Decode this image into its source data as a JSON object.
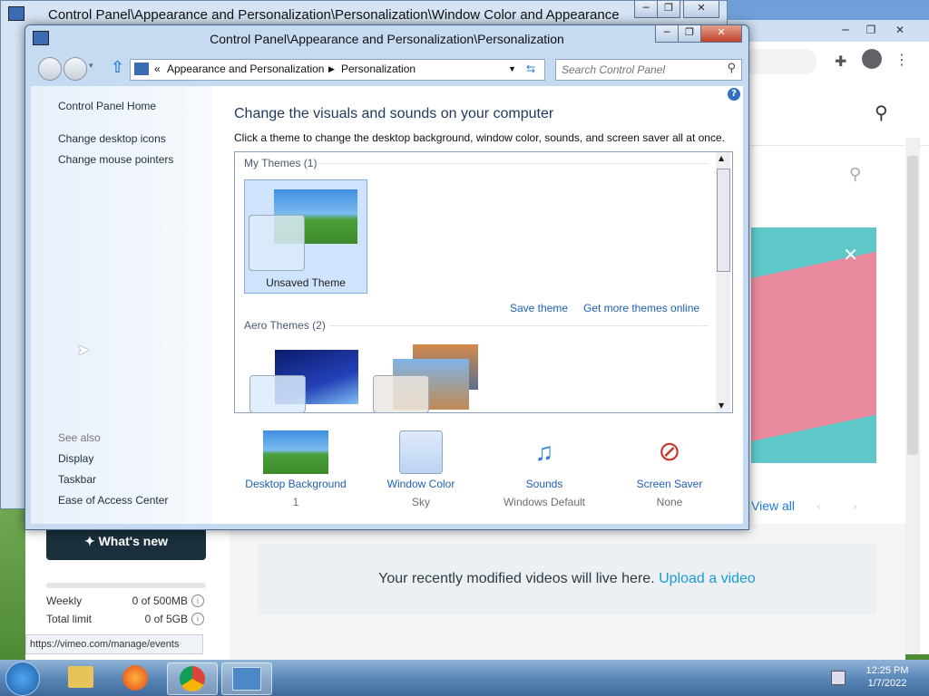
{
  "back_window": {
    "title": "Control Panel\\Appearance and Personalization\\Personalization\\Window Color and Appearance"
  },
  "browser": {
    "status_url": "https://vimeo.com/manage/events",
    "view_all": "View all",
    "whats_new": "What's new",
    "quota": [
      {
        "label": "Weekly",
        "value": "0 of 500MB"
      },
      {
        "label": "Total limit",
        "value": "0 of 5GB"
      }
    ],
    "recent_text": "Your recently modified videos will live here.",
    "upload_link": "Upload a video"
  },
  "window": {
    "title": "Control Panel\\Appearance and Personalization\\Personalization",
    "breadcrumb": [
      "Appearance and Personalization",
      "Personalization"
    ],
    "search_placeholder": "Search Control Panel",
    "sidebar": {
      "home": "Control Panel Home",
      "links": [
        "Change desktop icons",
        "Change mouse pointers"
      ],
      "see_also_title": "See also",
      "see_also": [
        "Display",
        "Taskbar",
        "Ease of Access Center"
      ]
    },
    "heading": "Change the visuals and sounds on your computer",
    "description": "Click a theme to change the desktop background, window color, sounds, and screen saver all at once.",
    "my_themes": {
      "title": "My Themes (1)",
      "items": [
        "Unsaved Theme"
      ]
    },
    "save_theme": "Save theme",
    "get_more": "Get more themes online",
    "aero_themes": {
      "title": "Aero Themes (2)"
    },
    "bottom": [
      {
        "label": "Desktop Background",
        "sub": "1",
        "icon": "desktop-background-icon"
      },
      {
        "label": "Window Color",
        "sub": "Sky",
        "icon": "window-color-icon"
      },
      {
        "label": "Sounds",
        "sub": "Windows Default",
        "icon": "sounds-icon"
      },
      {
        "label": "Screen Saver",
        "sub": "None",
        "icon": "screen-saver-icon"
      }
    ]
  },
  "taskbar": {
    "time": "12:25 PM",
    "date": "1/7/2022"
  }
}
